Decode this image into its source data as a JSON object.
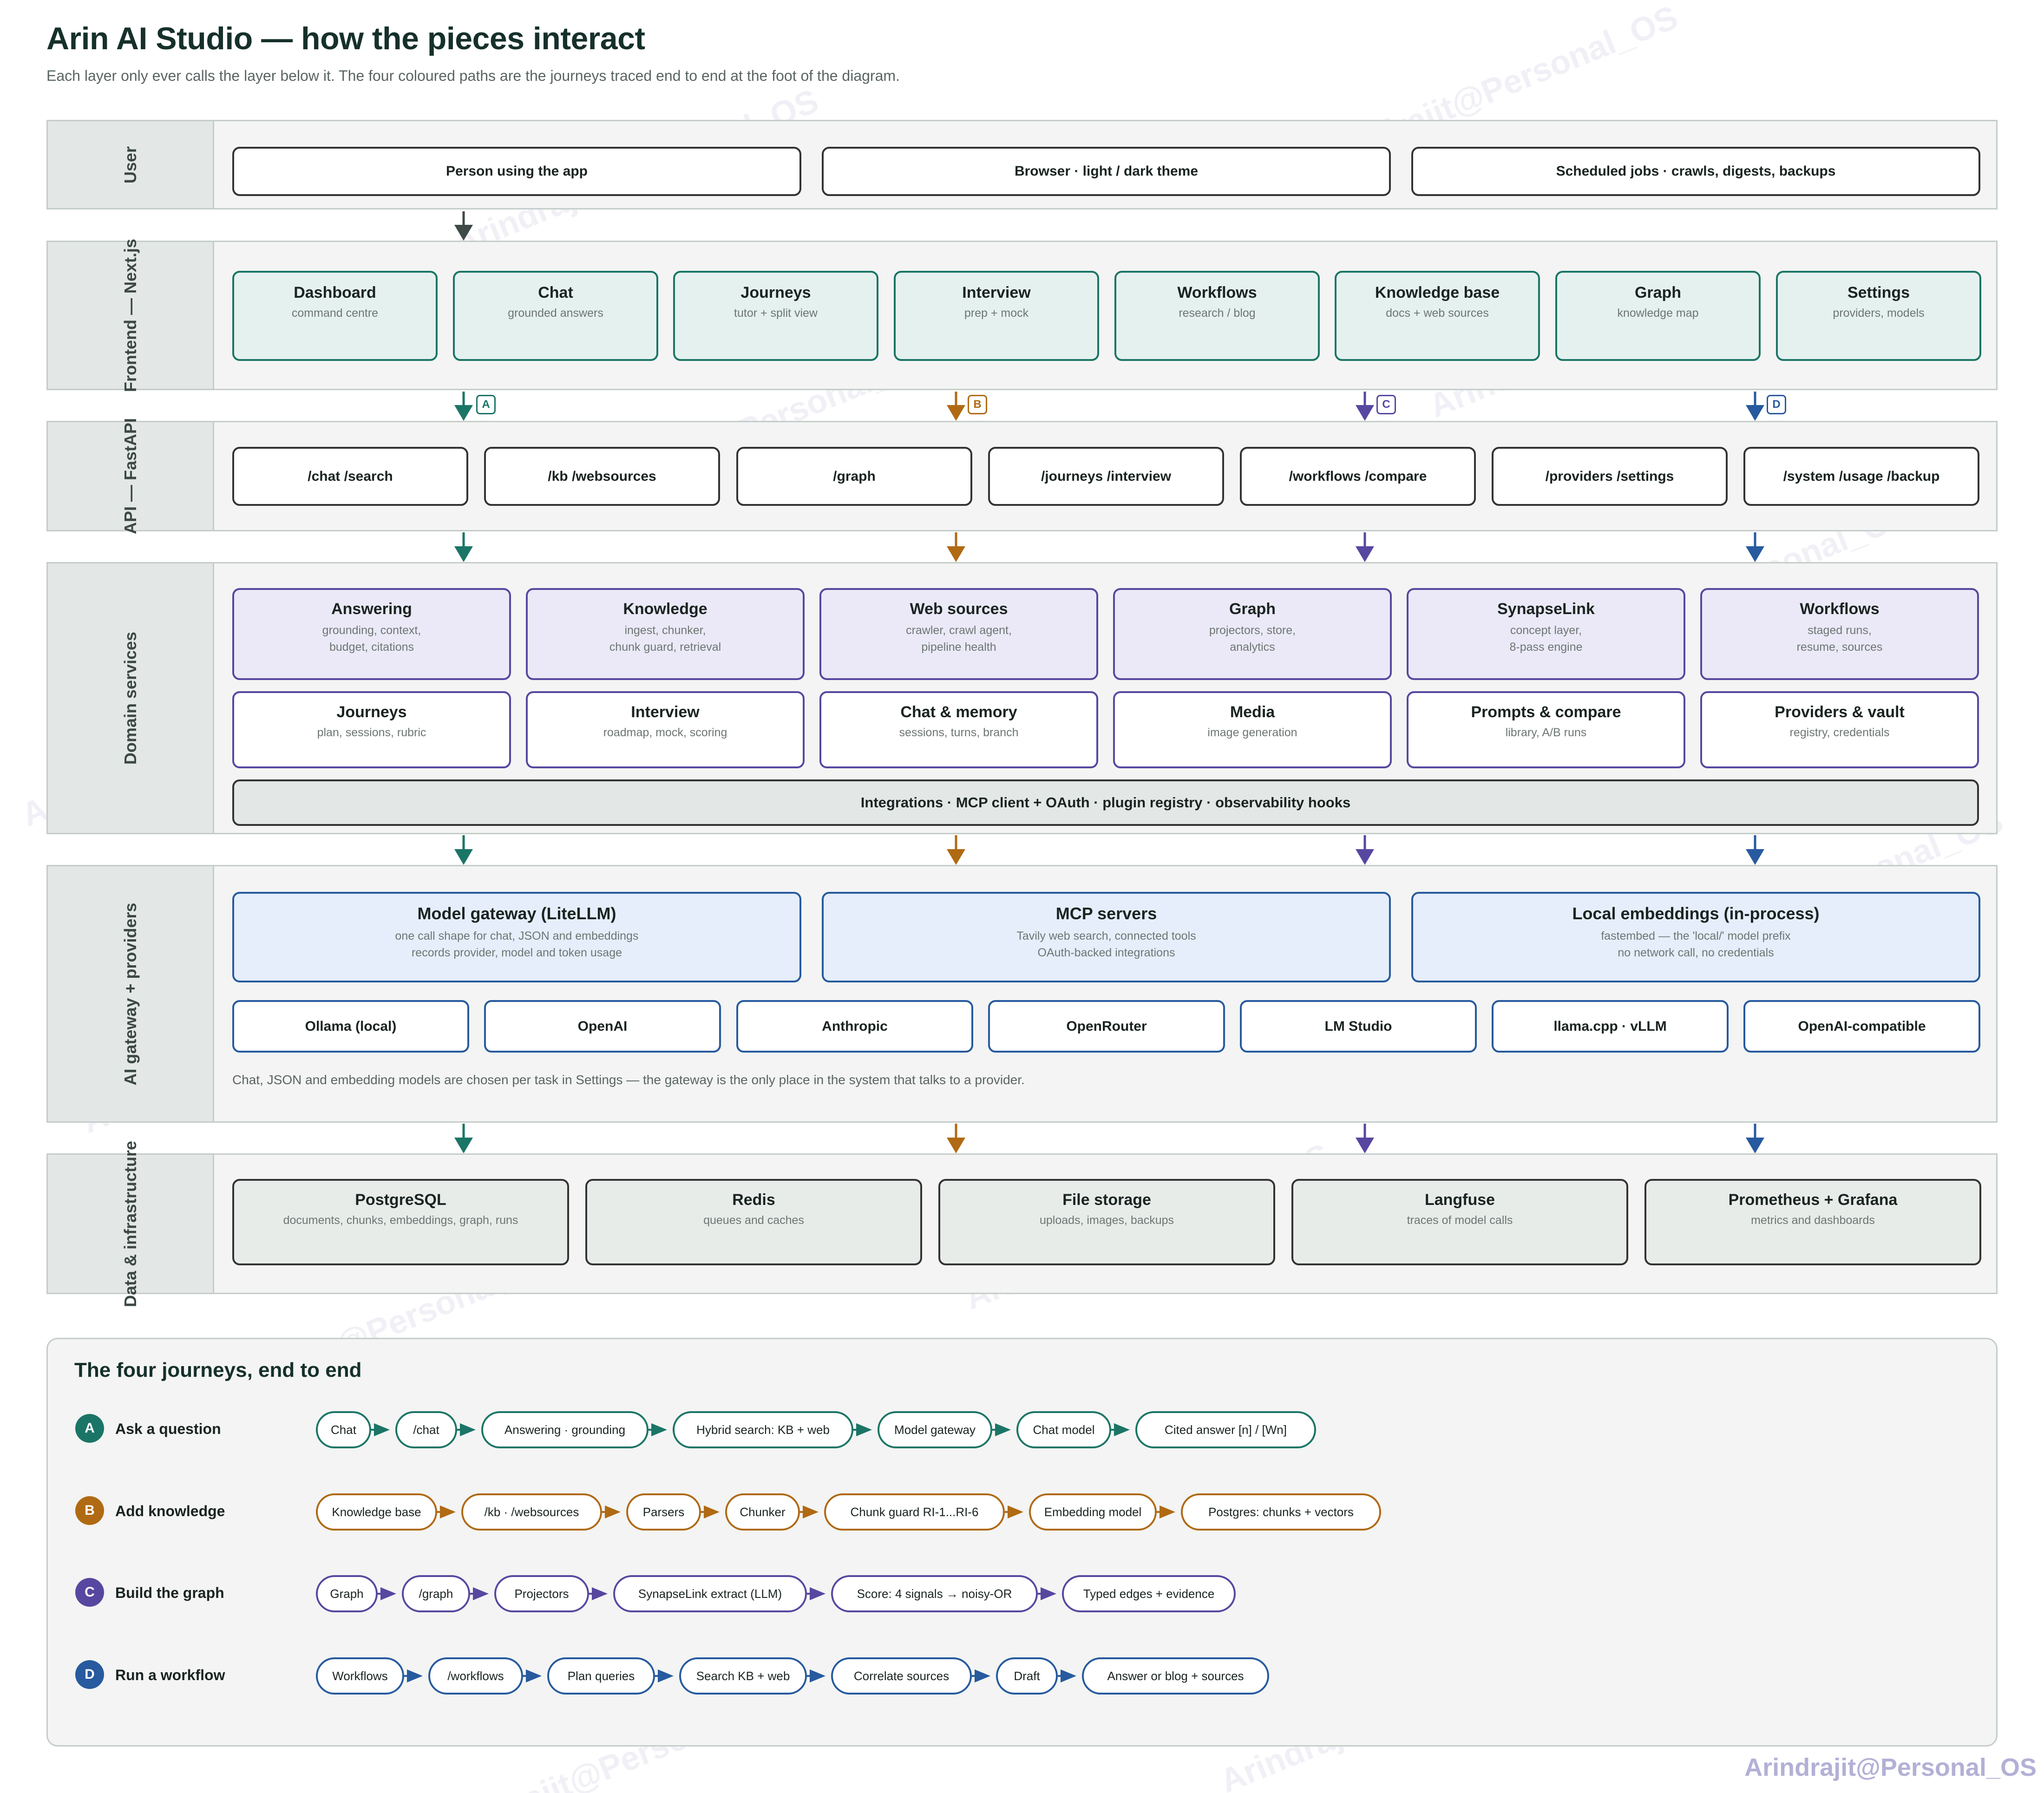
{
  "title": "Arin AI Studio — how the pieces interact",
  "subtitle": "Each layer only ever calls the layer below it. The four coloured paths are the journeys traced end to end at the foot of the diagram.",
  "colors": {
    "teal": "#1b7566",
    "orange": "#b06a14",
    "purple": "#5847a0",
    "blue": "#275a9e",
    "dark": "#3d4a47"
  },
  "layers": {
    "user": {
      "label": "User",
      "items": [
        "Person using the app",
        "Browser · light / dark theme",
        "Scheduled jobs · crawls, digests, backups"
      ]
    },
    "frontend": {
      "label": "Frontend — Next.js",
      "items": [
        {
          "title": "Dashboard",
          "sub": "command centre"
        },
        {
          "title": "Chat",
          "sub": "grounded answers"
        },
        {
          "title": "Journeys",
          "sub": "tutor + split view"
        },
        {
          "title": "Interview",
          "sub": "prep + mock"
        },
        {
          "title": "Workflows",
          "sub": "research / blog"
        },
        {
          "title": "Knowledge base",
          "sub": "docs + web sources"
        },
        {
          "title": "Graph",
          "sub": "knowledge map"
        },
        {
          "title": "Settings",
          "sub": "providers, models"
        }
      ]
    },
    "api": {
      "label": "API — FastAPI",
      "items": [
        "/chat /search",
        "/kb /websources",
        "/graph",
        "/journeys /interview",
        "/workflows /compare",
        "/providers /settings",
        "/system /usage /backup"
      ]
    },
    "domain": {
      "label": "Domain services",
      "row1": [
        {
          "title": "Answering",
          "sub1": "grounding, context,",
          "sub2": "budget, citations"
        },
        {
          "title": "Knowledge",
          "sub1": "ingest, chunker,",
          "sub2": "chunk guard, retrieval"
        },
        {
          "title": "Web sources",
          "sub1": "crawler, crawl agent,",
          "sub2": "pipeline health"
        },
        {
          "title": "Graph",
          "sub1": "projectors, store,",
          "sub2": "analytics"
        },
        {
          "title": "SynapseLink",
          "sub1": "concept layer,",
          "sub2": "8-pass engine"
        },
        {
          "title": "Workflows",
          "sub1": "staged runs,",
          "sub2": "resume, sources"
        }
      ],
      "row2": [
        {
          "title": "Journeys",
          "sub": "plan, sessions, rubric"
        },
        {
          "title": "Interview",
          "sub": "roadmap, mock, scoring"
        },
        {
          "title": "Chat & memory",
          "sub": "sessions, turns, branch"
        },
        {
          "title": "Media",
          "sub": "image generation"
        },
        {
          "title": "Prompts & compare",
          "sub": "library, A/B runs"
        },
        {
          "title": "Providers & vault",
          "sub": "registry, credentials"
        }
      ],
      "integrations": "Integrations · MCP client + OAuth · plugin registry · observability hooks"
    },
    "gateway": {
      "label": "AI gateway + providers",
      "main": [
        {
          "title": "Model gateway (LiteLLM)",
          "sub1": "one call shape for chat, JSON and embeddings",
          "sub2": "records provider, model and token usage"
        },
        {
          "title": "MCP servers",
          "sub1": "Tavily web search, connected tools",
          "sub2": "OAuth-backed integrations"
        },
        {
          "title": "Local embeddings (in-process)",
          "sub1": "fastembed — the 'local/' model prefix",
          "sub2": "no network call, no credentials"
        }
      ],
      "providers": [
        "Ollama (local)",
        "OpenAI",
        "Anthropic",
        "OpenRouter",
        "LM Studio",
        "llama.cpp · vLLM",
        "OpenAI-compatible"
      ],
      "note": "Chat, JSON and embedding models are chosen per task in Settings — the gateway is the only place in the system that talks to a provider."
    },
    "data": {
      "label": "Data & infrastructure",
      "items": [
        {
          "title": "PostgreSQL",
          "sub": "documents, chunks, embeddings, graph, runs"
        },
        {
          "title": "Redis",
          "sub": "queues and caches"
        },
        {
          "title": "File storage",
          "sub": "uploads, images, backups"
        },
        {
          "title": "Langfuse",
          "sub": "traces of model calls"
        },
        {
          "title": "Prometheus + Grafana",
          "sub": "metrics and dashboards"
        }
      ]
    }
  },
  "path_badges": [
    "A",
    "B",
    "C",
    "D"
  ],
  "journeys": {
    "title": "The four journeys, end to end",
    "items": [
      {
        "badge": "A",
        "name": "Ask a question",
        "color": "#1b7566",
        "steps": [
          "Chat",
          "/chat",
          "Answering · grounding",
          "Hybrid search: KB + web",
          "Model gateway",
          "Chat model",
          "Cited answer [n] / [Wn]"
        ]
      },
      {
        "badge": "B",
        "name": "Add knowledge",
        "color": "#b06a14",
        "steps": [
          "Knowledge base",
          "/kb · /websources",
          "Parsers",
          "Chunker",
          "Chunk guard RI-1...RI-6",
          "Embedding model",
          "Postgres: chunks + vectors"
        ]
      },
      {
        "badge": "C",
        "name": "Build the graph",
        "color": "#5847a0",
        "steps": [
          "Graph",
          "/graph",
          "Projectors",
          "SynapseLink extract (LLM)",
          "Score: 4 signals → noisy-OR",
          "Typed edges + evidence"
        ]
      },
      {
        "badge": "D",
        "name": "Run a workflow",
        "color": "#275a9e",
        "steps": [
          "Workflows",
          "/workflows",
          "Plan queries",
          "Search KB + web",
          "Correlate sources",
          "Draft",
          "Answer or blog + sources"
        ]
      }
    ]
  },
  "watermark": "Arindrajit@Personal_OS"
}
